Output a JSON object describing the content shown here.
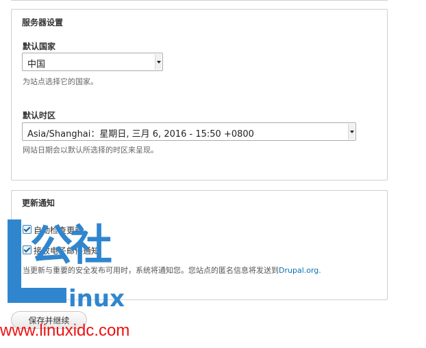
{
  "server_settings": {
    "legend": "服务器设置",
    "country": {
      "label": "默认国家",
      "value": "中国",
      "description": "为站点选择它的国家。"
    },
    "timezone": {
      "label": "默认时区",
      "value": "Asia/Shanghai：星期日, 三月 6, 2016 - 15:50 +0800",
      "description": "网站日期会以默认所选择的时区来呈现。"
    }
  },
  "update_notifications": {
    "legend": "更新通知",
    "auto_check": {
      "label": "自动检查更新",
      "checked": true
    },
    "email": {
      "label": "接收电子邮件通知",
      "checked": true
    },
    "notice_text": "当更新与重要的安全发布可用时，系统将通知您。您站点的匿名信息将发送到",
    "notice_link": "Drupal.org."
  },
  "submit_button": "保存并继续",
  "watermark": {
    "letter": "L",
    "chinese": "公社",
    "linux": "inux",
    "url": "www.linuxidc.com",
    "color": "#2f86cf",
    "url_color": "#ee1111"
  }
}
